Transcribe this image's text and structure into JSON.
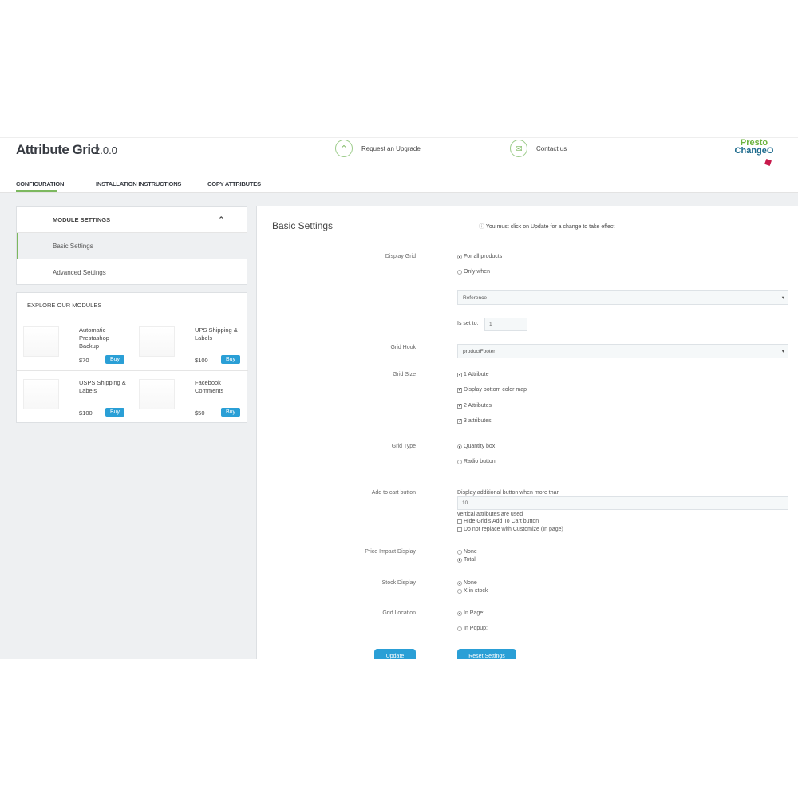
{
  "header": {
    "title": "Attribute Grid",
    "version": "2.0.0",
    "upgrade_label": "Request an Upgrade",
    "contact_label": "Contact us",
    "logo_text": "PrestO ChangeO"
  },
  "tabs": [
    {
      "label": "CONFIGURATION",
      "active": true
    },
    {
      "label": "INSTALLATION INSTRUCTIONS"
    },
    {
      "label": "COPY ATTRIBUTES"
    }
  ],
  "sidebar": {
    "section_title": "MODULE SETTINGS",
    "items": [
      {
        "label": "Basic Settings",
        "active": true
      },
      {
        "label": "Advanced Settings"
      }
    ]
  },
  "explore": {
    "title": "EXPLORE OUR MODULES",
    "buy_label": "Buy",
    "modules": [
      {
        "name": "Automatic Prestashop Backup",
        "price": "$70"
      },
      {
        "name": "UPS Shipping & Labels",
        "price": "$100"
      },
      {
        "name": "USPS Shipping & Labels",
        "price": "$100"
      },
      {
        "name": "Facebook Comments",
        "price": "$50"
      }
    ]
  },
  "main": {
    "title": "Basic Settings",
    "notice": "You must click on Update for a change to take effect",
    "display_grid": {
      "label": "Display Grid",
      "options": [
        "For all products",
        "Only when"
      ],
      "selected": 0,
      "field_select": "Reference",
      "is_set_to_label": "Is set to:",
      "is_set_to_value": "1"
    },
    "grid_hook": {
      "label": "Grid Hook",
      "value": "productFooter"
    },
    "grid_size": {
      "label": "Grid Size",
      "options": [
        {
          "label": "1 Attribute",
          "checked": true
        },
        {
          "label": "Display bottom color map",
          "checked": true
        },
        {
          "label": "2 Attributes",
          "checked": true
        },
        {
          "label": "3 attributes",
          "checked": true
        }
      ]
    },
    "grid_type": {
      "label": "Grid Type",
      "options": [
        "Quantity box",
        "Radio button"
      ],
      "selected": 0
    },
    "add_to_cart": {
      "label": "Add to cart button",
      "before": "Display additional button when more than",
      "value": "10",
      "after": "vertical attributes are used",
      "checks": [
        {
          "label": "Hide Grid's Add To Cart button",
          "checked": false
        },
        {
          "label": "Do not replace with Customize (In page)",
          "checked": false
        }
      ]
    },
    "price_impact": {
      "label": "Price Impact Display",
      "options": [
        "None",
        "Total"
      ],
      "selected": 1
    },
    "stock_display": {
      "label": "Stock Display",
      "options": [
        "None",
        "X in stock"
      ],
      "selected": 0
    },
    "grid_location": {
      "label": "Grid Location",
      "options": [
        "In Page:",
        "In Popup:"
      ],
      "selected": 0
    },
    "update_label": "Update",
    "reset_label": "Reset Settings"
  },
  "colors": {
    "accent": "#2a9fd6",
    "active_tab": "#7cb85f",
    "background": "#eef0f2"
  }
}
